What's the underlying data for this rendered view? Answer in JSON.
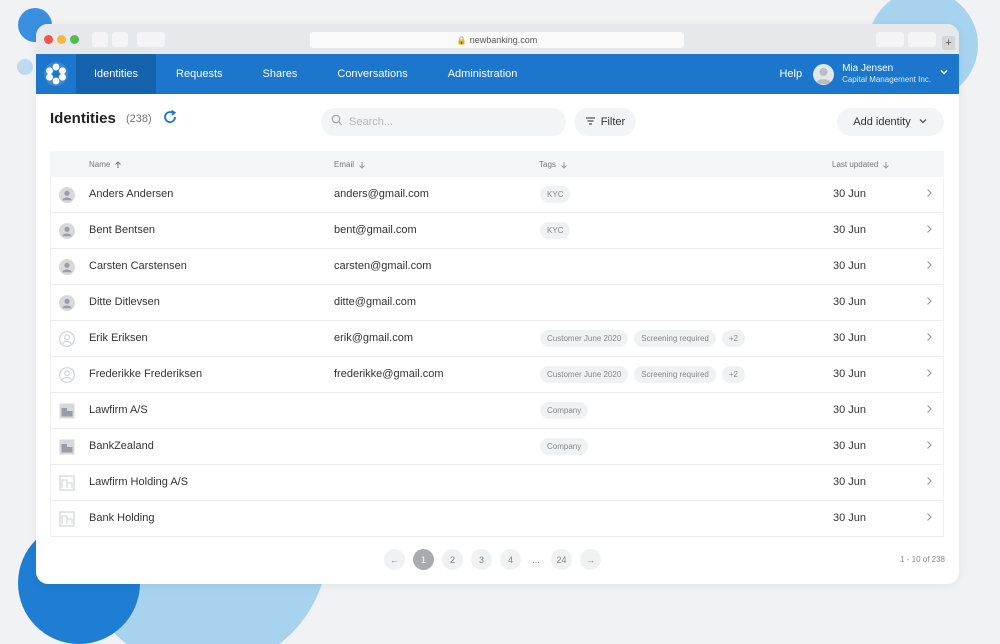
{
  "browser": {
    "url": "newbanking.com",
    "new_tab": "+"
  },
  "nav": {
    "items": [
      {
        "label": "Identities",
        "active": true
      },
      {
        "label": "Requests"
      },
      {
        "label": "Shares"
      },
      {
        "label": "Conversations"
      },
      {
        "label": "Administration"
      }
    ],
    "help": "Help",
    "user_name": "Mia Jensen",
    "user_company": "Capital Management Inc."
  },
  "toolbar": {
    "title": "Identities",
    "count": "(238)",
    "search_placeholder": "Search...",
    "filter_label": "Filter",
    "add_label": "Add identity"
  },
  "table": {
    "headers": {
      "name": "Name",
      "email": "Email",
      "tags": "Tags",
      "updated": "Last updated"
    },
    "rows": [
      {
        "type": "person",
        "name": "Anders Andersen",
        "email": "anders@gmail.com",
        "tags": [
          "KYC"
        ],
        "updated": "30 Jun"
      },
      {
        "type": "person",
        "name": "Bent Bentsen",
        "email": "bent@gmail.com",
        "tags": [
          "KYC"
        ],
        "updated": "30 Jun"
      },
      {
        "type": "person",
        "name": "Carsten Carstensen",
        "email": "carsten@gmail.com",
        "tags": [],
        "updated": "30 Jun"
      },
      {
        "type": "person",
        "name": "Ditte Ditlevsen",
        "email": "ditte@gmail.com",
        "tags": [],
        "updated": "30 Jun"
      },
      {
        "type": "person-outline",
        "name": "Erik Eriksen",
        "email": "erik@gmail.com",
        "tags": [
          "Customer June 2020",
          "Screening required",
          "+2"
        ],
        "updated": "30 Jun"
      },
      {
        "type": "person-outline",
        "name": "Frederikke Frederiksen",
        "email": "frederikke@gmail.com",
        "tags": [
          "Customer June 2020",
          "Screening required",
          "+2"
        ],
        "updated": "30 Jun"
      },
      {
        "type": "company",
        "name": "Lawfirm A/S",
        "email": "",
        "tags": [
          "Company"
        ],
        "updated": "30 Jun"
      },
      {
        "type": "company",
        "name": "BankZealand",
        "email": "",
        "tags": [
          "Company"
        ],
        "updated": "30 Jun"
      },
      {
        "type": "company-outline",
        "name": "Lawfirm Holding A/S",
        "email": "",
        "tags": [],
        "updated": "30 Jun"
      },
      {
        "type": "company-outline",
        "name": "Bank Holding",
        "email": "",
        "tags": [],
        "updated": "30 Jun"
      }
    ]
  },
  "pagination": {
    "prev": "←",
    "pages": [
      "1",
      "2",
      "3",
      "4"
    ],
    "ellipsis": "...",
    "last": "24",
    "next": "→",
    "current": "1",
    "range": "1 - 10 of 238"
  },
  "colors": {
    "brand": "#1b76cc",
    "nav_active": "#1563ad",
    "refresh": "#1b76cc"
  }
}
